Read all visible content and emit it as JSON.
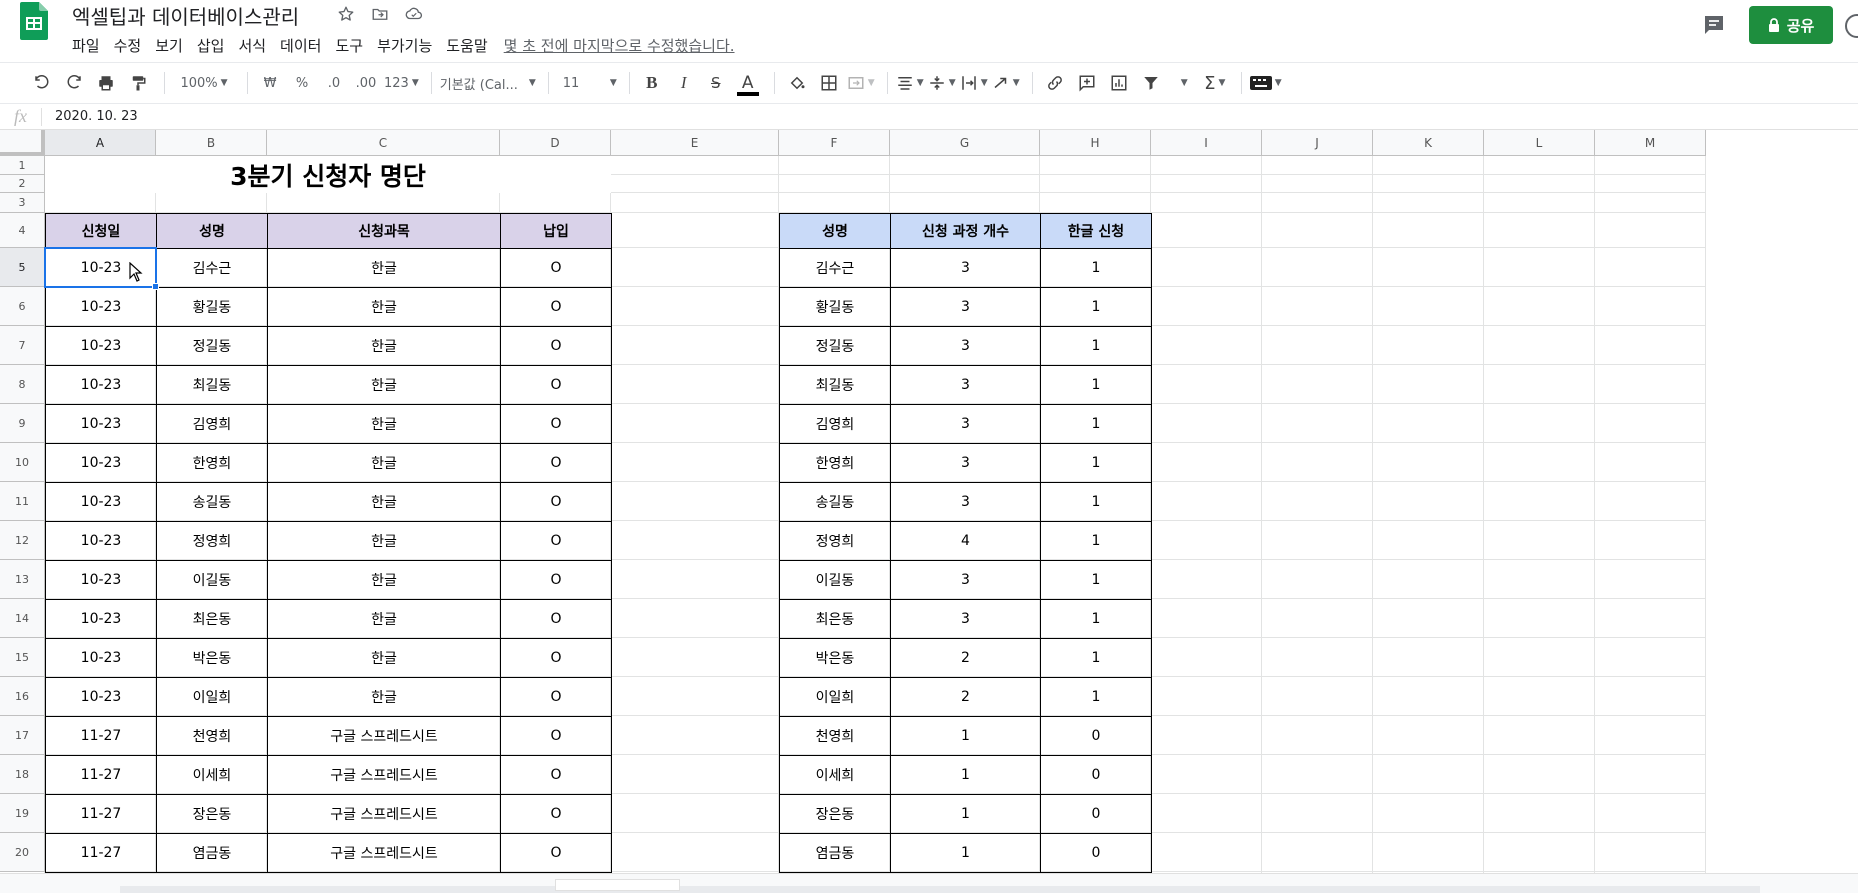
{
  "document": {
    "title": "엑셀팁과 데이터베이스관리",
    "last_edit": "몇 초 전에 마지막으로 수정했습니다."
  },
  "menu": [
    "파일",
    "수정",
    "보기",
    "삽입",
    "서식",
    "데이터",
    "도구",
    "부가기능",
    "도움말"
  ],
  "share_label": "공유",
  "toolbar": {
    "zoom": "100%",
    "currency": "₩",
    "percent": "%",
    "dec_decrease": ".0",
    "dec_increase": ".00",
    "more_formats": "123",
    "font": "기본값 (Cal...",
    "font_size": "11",
    "bold": "B",
    "italic": "I",
    "strike": "S",
    "text_color": "A"
  },
  "formula_bar": {
    "fx": "fx",
    "value": "2020. 10. 23"
  },
  "columns": [
    "A",
    "B",
    "C",
    "D",
    "E",
    "F",
    "G",
    "H",
    "I",
    "J",
    "K",
    "L",
    "M"
  ],
  "rows": [
    "1",
    "2",
    "3",
    "4",
    "5",
    "6",
    "7",
    "8",
    "9",
    "10",
    "11",
    "12",
    "13",
    "14",
    "15",
    "16",
    "17",
    "18",
    "19",
    "20"
  ],
  "sheet_title": "3분기 신청자 명단",
  "left_table": {
    "headers": [
      "신청일",
      "성명",
      "신청과목",
      "납입"
    ],
    "rows": [
      [
        "10-23",
        "김수근",
        "한글",
        "O"
      ],
      [
        "10-23",
        "황길동",
        "한글",
        "O"
      ],
      [
        "10-23",
        "정길동",
        "한글",
        "O"
      ],
      [
        "10-23",
        "최길동",
        "한글",
        "O"
      ],
      [
        "10-23",
        "김영희",
        "한글",
        "O"
      ],
      [
        "10-23",
        "한영희",
        "한글",
        "O"
      ],
      [
        "10-23",
        "송길동",
        "한글",
        "O"
      ],
      [
        "10-23",
        "정영희",
        "한글",
        "O"
      ],
      [
        "10-23",
        "이길동",
        "한글",
        "O"
      ],
      [
        "10-23",
        "최은동",
        "한글",
        "O"
      ],
      [
        "10-23",
        "박은동",
        "한글",
        "O"
      ],
      [
        "10-23",
        "이일희",
        "한글",
        "O"
      ],
      [
        "11-27",
        "천영희",
        "구글 스프레드시트",
        "O"
      ],
      [
        "11-27",
        "이세희",
        "구글 스프레드시트",
        "O"
      ],
      [
        "11-27",
        "장은동",
        "구글 스프레드시트",
        "O"
      ],
      [
        "11-27",
        "염금동",
        "구글 스프레드시트",
        "O"
      ]
    ]
  },
  "right_table": {
    "headers": [
      "성명",
      "신청 과정 개수",
      "한글 신청"
    ],
    "rows": [
      [
        "김수근",
        "3",
        "1"
      ],
      [
        "황길동",
        "3",
        "1"
      ],
      [
        "정길동",
        "3",
        "1"
      ],
      [
        "최길동",
        "3",
        "1"
      ],
      [
        "김영희",
        "3",
        "1"
      ],
      [
        "한영희",
        "3",
        "1"
      ],
      [
        "송길동",
        "3",
        "1"
      ],
      [
        "정영희",
        "4",
        "1"
      ],
      [
        "이길동",
        "3",
        "1"
      ],
      [
        "최은동",
        "3",
        "1"
      ],
      [
        "박은동",
        "2",
        "1"
      ],
      [
        "이일희",
        "2",
        "1"
      ],
      [
        "천영희",
        "1",
        "0"
      ],
      [
        "이세희",
        "1",
        "0"
      ],
      [
        "장은동",
        "1",
        "0"
      ],
      [
        "염금동",
        "1",
        "0"
      ]
    ]
  },
  "colors": {
    "header_purple": "#d9d2e9",
    "header_blue": "#c9daf8",
    "share_green": "#1e8e3e",
    "selection_blue": "#1a73e8"
  }
}
